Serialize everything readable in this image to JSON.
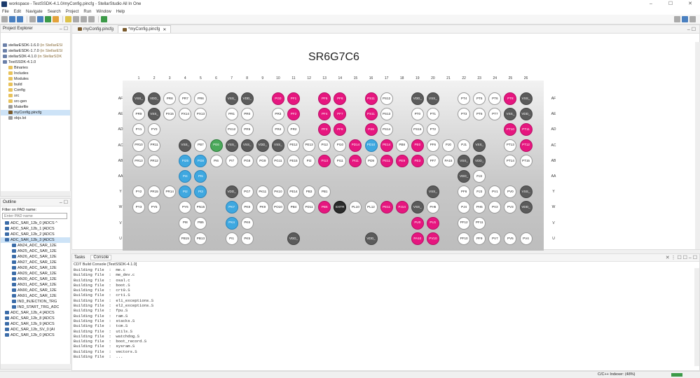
{
  "window": {
    "title": "workspace - TestSSDK-4.1.0/myConfig.pincfg - StellarStudio All In One",
    "controls": [
      "–",
      "☐",
      "✕"
    ]
  },
  "menu": [
    "File",
    "Edit",
    "Navigate",
    "Search",
    "Project",
    "Run",
    "Window",
    "Help"
  ],
  "project_explorer": {
    "title": "Project Explorer",
    "items": [
      {
        "label": "stellarESDK-1.6.0",
        "muted": " (in StellarESI",
        "indent": 0
      },
      {
        "label": "stellarESDK-1.7.0",
        "muted": " (in StellarESI",
        "indent": 0
      },
      {
        "label": "stellarSDK-4.1.0",
        "muted": " (in StellarSDK",
        "indent": 0
      },
      {
        "label": "TestSSDK-4.1.0",
        "muted": "",
        "indent": 0
      },
      {
        "label": "Binaries",
        "muted": "",
        "indent": 1
      },
      {
        "label": "Includes",
        "muted": "",
        "indent": 1
      },
      {
        "label": "Modules",
        "muted": "",
        "indent": 1
      },
      {
        "label": "build",
        "muted": "",
        "indent": 1
      },
      {
        "label": "Config",
        "muted": "",
        "indent": 1
      },
      {
        "label": "src",
        "muted": "",
        "indent": 1
      },
      {
        "label": "src-gen",
        "muted": "",
        "indent": 1
      },
      {
        "label": "Makefile",
        "muted": "",
        "indent": 1
      },
      {
        "label": "myConfig.pincfg",
        "muted": "",
        "indent": 1
      },
      {
        "label": "objs.lst",
        "muted": "",
        "indent": 1
      }
    ]
  },
  "outline": {
    "title": "Outline",
    "filter_label": "Filter on PAD name:",
    "filter_placeholder": "Enter PAD name",
    "items": [
      {
        "label": "ADC_SAR_12b_0 [ADCS ^",
        "indent": 0
      },
      {
        "label": "ADC_SAR_12b_1 [ADCS",
        "indent": 0
      },
      {
        "label": "ADC_SAR_12b_2 [ADCS",
        "indent": 0
      },
      {
        "label": "ADC_SAR_12b_3 [ADCS",
        "indent": 0
      },
      {
        "label": "AN24_ADC_SAR_12E",
        "indent": 1
      },
      {
        "label": "AN25_ADC_SAR_12E",
        "indent": 1
      },
      {
        "label": "AN26_ADC_SAR_12E",
        "indent": 1
      },
      {
        "label": "AN27_ADC_SAR_12E",
        "indent": 1
      },
      {
        "label": "AN28_ADC_SAR_12E",
        "indent": 1
      },
      {
        "label": "AN29_ADC_SAR_12E",
        "indent": 1
      },
      {
        "label": "AN30_ADC_SAR_12E",
        "indent": 1
      },
      {
        "label": "AN31_ADC_SAR_12E",
        "indent": 1
      },
      {
        "label": "AN90_ADC_SAR_12E",
        "indent": 1
      },
      {
        "label": "AN91_ADC_SAR_12E",
        "indent": 1
      },
      {
        "label": "IND_INJECTION_TRG",
        "indent": 1
      },
      {
        "label": "IND_START_TRG_ADC",
        "indent": 1
      },
      {
        "label": "ADC_SAR_12b_4 [ADCS",
        "indent": 0
      },
      {
        "label": "ADC_SAR_12b_8 [ADCS",
        "indent": 0
      },
      {
        "label": "ADC_SAR_12b_9 [ADCS",
        "indent": 0
      },
      {
        "label": "ADC_SAR_12b_SV_0 [AI",
        "indent": 0
      },
      {
        "label": "ADC_SAR_12b_0 [ADCS ",
        "indent": 0
      }
    ]
  },
  "editor": {
    "tabs": [
      "myConfig.pincfg",
      "*myConfig.pincfg"
    ],
    "chip_name": "SR6G7C6",
    "columns": [
      "1",
      "2",
      "3",
      "4",
      "5",
      "6",
      "7",
      "8",
      "9",
      "10",
      "11",
      "12",
      "13",
      "14",
      "15",
      "16",
      "17",
      "18",
      "19",
      "20",
      "21",
      "22",
      "23",
      "24",
      "25",
      "26"
    ],
    "rows": [
      {
        "label": "AF",
        "pins": [
          [
            "VSS_",
            "dark"
          ],
          [
            "VDD_",
            "dark"
          ],
          [
            "PR8",
            ""
          ],
          [
            "PR7",
            ""
          ],
          [
            "PR6",
            ""
          ],
          null,
          [
            "VSS_",
            "dark"
          ],
          [
            "VDD_",
            "dark"
          ],
          null,
          [
            "PG0",
            "magenta"
          ],
          [
            "PF1",
            "magenta"
          ],
          null,
          [
            "PF5",
            "magenta"
          ],
          [
            "PF6",
            "magenta"
          ],
          null,
          [
            "PS11",
            "magenta"
          ],
          [
            "PS12",
            ""
          ],
          null,
          [
            "VDD_",
            "dark"
          ],
          [
            "VSS_",
            "dark"
          ],
          null,
          [
            "PT4",
            ""
          ],
          [
            "PT5",
            ""
          ],
          [
            "PT6",
            ""
          ],
          [
            "PT8",
            "magenta"
          ],
          [
            "VSS_",
            "dark"
          ]
        ]
      },
      {
        "label": "AE",
        "pins": [
          [
            "PR9",
            ""
          ],
          [
            "VSS_",
            "dark"
          ],
          [
            "PX15",
            ""
          ],
          [
            "PX14",
            ""
          ],
          [
            "PX13",
            ""
          ],
          null,
          [
            "PR1",
            ""
          ],
          [
            "PR0",
            ""
          ],
          null,
          [
            "PR3",
            ""
          ],
          [
            "PF2",
            "magenta"
          ],
          null,
          [
            "PF4",
            "magenta"
          ],
          [
            "PF7",
            "magenta"
          ],
          null,
          [
            "PS11",
            "magenta"
          ],
          [
            "PS13",
            ""
          ],
          null,
          [
            "PT0",
            ""
          ],
          [
            "PT1",
            ""
          ],
          null,
          [
            "PT3",
            ""
          ],
          [
            "PT6",
            ""
          ],
          [
            "PT7",
            ""
          ],
          [
            "VSS_",
            "dark"
          ],
          [
            "VDD_",
            "dark"
          ]
        ]
      },
      {
        "label": "AD",
        "pins": [
          [
            "PY1",
            ""
          ],
          [
            "PY0",
            ""
          ],
          null,
          null,
          null,
          null,
          [
            "PX12",
            ""
          ],
          [
            "PR5",
            ""
          ],
          null,
          [
            "PR4",
            ""
          ],
          [
            "PR2",
            ""
          ],
          null,
          [
            "PF3",
            "magenta"
          ],
          [
            "PF8",
            "magenta"
          ],
          null,
          [
            "PS9",
            "magenta"
          ],
          [
            "PS14",
            ""
          ],
          null,
          [
            "PS15",
            ""
          ],
          [
            "PT2",
            ""
          ],
          null,
          null,
          null,
          null,
          [
            "PT10",
            "magenta"
          ],
          [
            "PT11",
            "magenta"
          ]
        ]
      },
      {
        "label": "AC",
        "pins": [
          [
            "PR10",
            ""
          ],
          [
            "PR11",
            ""
          ],
          null,
          [
            "VSS_",
            "dark"
          ],
          [
            "PB7",
            ""
          ],
          [
            "PE6",
            "green"
          ],
          [
            "VSS_",
            "dark"
          ],
          [
            "VSS_",
            "dark"
          ],
          [
            "VDD_",
            "dark"
          ],
          [
            "VSS_",
            "dark"
          ],
          [
            "PE12",
            ""
          ],
          [
            "PE13",
            ""
          ],
          [
            "PI12",
            ""
          ],
          [
            "PI10",
            ""
          ],
          [
            "PD14",
            "magenta"
          ],
          [
            "PD10",
            "blue"
          ],
          [
            "PE14",
            "magenta"
          ],
          [
            "PB8",
            ""
          ],
          [
            "PE0",
            "magenta"
          ],
          [
            "PF6",
            ""
          ],
          [
            "PJ0",
            ""
          ],
          [
            "PJ1",
            ""
          ],
          [
            "VSS_",
            "dark"
          ],
          null,
          [
            "PT13",
            ""
          ],
          [
            "PT12",
            "magenta"
          ]
        ]
      },
      {
        "label": "AB",
        "pins": [
          [
            "PR13",
            ""
          ],
          [
            "PR12",
            ""
          ],
          null,
          [
            "PI25",
            "blue"
          ],
          [
            "PG8",
            "blue"
          ],
          [
            "PI6",
            ""
          ],
          [
            "PI7",
            ""
          ],
          [
            "PG8",
            ""
          ],
          [
            "PG9",
            ""
          ],
          [
            "PG11",
            ""
          ],
          [
            "PE15",
            ""
          ],
          [
            "PI2",
            ""
          ],
          [
            "PI13",
            "magenta"
          ],
          [
            "PI11",
            ""
          ],
          [
            "PI11",
            "magenta"
          ],
          [
            "PD9",
            ""
          ],
          [
            "PE11",
            "magenta"
          ],
          [
            "PE9",
            "magenta"
          ],
          [
            "PE3",
            "magenta"
          ],
          [
            "PF7",
            ""
          ],
          [
            "PA15",
            ""
          ],
          [
            "VSS_",
            "dark"
          ],
          [
            "VDD_",
            "dark"
          ],
          null,
          [
            "PT14",
            ""
          ],
          [
            "PT15",
            ""
          ]
        ]
      },
      {
        "label": "AA",
        "pins": [
          null,
          null,
          null,
          [
            "PI4",
            "blue"
          ],
          [
            "PI5",
            "blue"
          ],
          null,
          null,
          null,
          null,
          null,
          null,
          null,
          null,
          null,
          null,
          null,
          null,
          null,
          null,
          null,
          null,
          [
            "VDD_",
            "dark"
          ],
          [
            "PJ2",
            ""
          ],
          null,
          null,
          null
        ]
      },
      {
        "label": "Y",
        "pins": [
          [
            "PY2",
            ""
          ],
          [
            "PR15",
            ""
          ],
          [
            "PR14",
            ""
          ],
          [
            "PI2",
            "blue"
          ],
          [
            "PI3",
            "blue"
          ],
          null,
          [
            "VDD_",
            "dark"
          ],
          [
            "PG7",
            ""
          ],
          [
            "PK11",
            ""
          ],
          [
            "PK10",
            ""
          ],
          [
            "PE14",
            ""
          ],
          [
            "PB3",
            ""
          ],
          [
            "PB1",
            ""
          ],
          null,
          null,
          null,
          null,
          null,
          null,
          [
            "VSS_",
            "dark"
          ],
          null,
          [
            "PF6",
            ""
          ],
          [
            "PJ3",
            ""
          ],
          [
            "PV1",
            ""
          ],
          [
            "PV0",
            ""
          ],
          [
            "VSS_",
            "dark"
          ]
        ]
      },
      {
        "label": "W",
        "pins": [
          [
            "PY3",
            ""
          ],
          [
            "PY5",
            ""
          ],
          null,
          [
            "PY6",
            ""
          ],
          [
            "PN15",
            ""
          ],
          null,
          [
            "PK7",
            "blue"
          ],
          [
            "PK8",
            ""
          ],
          [
            "PK9",
            ""
          ],
          [
            "PO10",
            ""
          ],
          [
            "PB4",
            ""
          ],
          [
            "PD11",
            ""
          ],
          [
            "PB6",
            "magenta"
          ],
          [
            "EXTR",
            "black"
          ],
          [
            "PL10",
            ""
          ],
          [
            "PL12",
            ""
          ],
          [
            "PE11",
            "magenta"
          ],
          [
            "PJ14",
            "magenta"
          ],
          [
            "VSS_",
            "dark"
          ],
          [
            "PH6",
            ""
          ],
          null,
          [
            "PJ4",
            ""
          ],
          [
            "PH5",
            ""
          ],
          [
            "PV2",
            ""
          ],
          [
            "PV3",
            ""
          ],
          [
            "VDD_",
            "dark"
          ]
        ]
      },
      {
        "label": "V",
        "pins": [
          null,
          null,
          null,
          [
            "PI8",
            ""
          ],
          [
            "PB5",
            ""
          ],
          null,
          [
            "PK4",
            "blue"
          ],
          [
            "PK6",
            ""
          ],
          null,
          null,
          null,
          null,
          null,
          null,
          null,
          null,
          null,
          null,
          [
            "PU0",
            "magenta"
          ],
          [
            "PU1",
            "magenta"
          ],
          null,
          [
            "PF12",
            ""
          ],
          [
            "PF11",
            ""
          ],
          null,
          null,
          null
        ]
      },
      {
        "label": "U",
        "pins": [
          null,
          null,
          null,
          [
            "PB15",
            ""
          ],
          [
            "PB13",
            ""
          ],
          null,
          [
            "PI1",
            ""
          ],
          [
            "PK5",
            ""
          ],
          null,
          null,
          [
            "VDD_",
            "dark"
          ],
          null,
          null,
          null,
          null,
          [
            "VDD_",
            "dark"
          ],
          null,
          null,
          [
            "PA10",
            "magenta"
          ],
          [
            "PV10",
            "magenta"
          ],
          null,
          [
            "PF10",
            ""
          ],
          [
            "PF9",
            ""
          ],
          [
            "PV7",
            ""
          ],
          [
            "PV5",
            ""
          ],
          [
            "PV4",
            ""
          ]
        ]
      }
    ]
  },
  "console": {
    "tabs": [
      "Tasks",
      "Console"
    ],
    "header": "CDT Build Console [TestSSDK-4.1.0]",
    "lines": [
      "Building file  :  me.c",
      "Building file  :  me_dev.c",
      "Building file  :  osal.c",
      "Building file  :  boot.S",
      "Building file  :  crt0.S",
      "Building file  :  crt1.S",
      "Building file  :  el1_exceptions.S",
      "Building file  :  el2_exceptions.S",
      "Building file  :  fpu.S",
      "Building file  :  ram.S",
      "Building file  :  stacks.S",
      "Building file  :  tcm.S",
      "Building file  :  utils.S",
      "Building file  :  watchdog.S",
      "Building file  :  boot_record.S",
      "Building file  :  sysram.S",
      "Building file  :  vectors.S",
      "Building file  :  ..."
    ]
  },
  "status": {
    "indexer": "C/C++ Indexer: (48%)",
    "indexer_progress": 0.48
  }
}
